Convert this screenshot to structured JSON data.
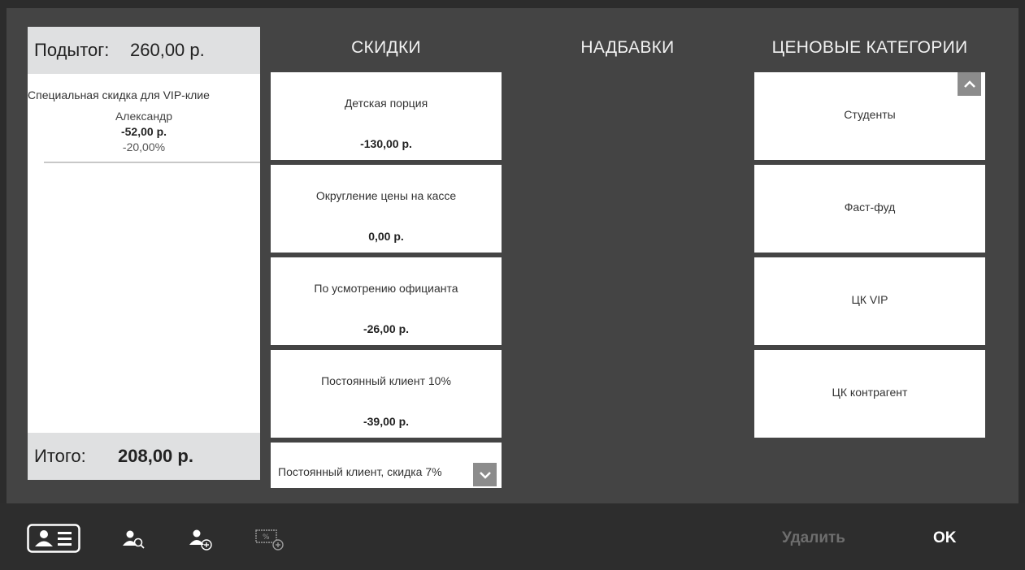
{
  "receipt": {
    "subtotal_label": "Подытог:",
    "subtotal_value": "260,00 р.",
    "discount_name": "Специальная скидка для VIP-клие",
    "discount_customer": "Александр",
    "discount_amount": "-52,00 р.",
    "discount_percent": "-20,00%",
    "total_label": "Итого:",
    "total_value": "208,00 р."
  },
  "columns": {
    "discounts": "СКИДКИ",
    "surcharges": "НАДБАВКИ",
    "price_categories": "ЦЕНОВЫЕ КАТЕГОРИИ"
  },
  "discounts": [
    {
      "name": "Детская порция",
      "amount": "-130,00 р."
    },
    {
      "name": "Округление цены на кассе",
      "amount": "0,00 р."
    },
    {
      "name": "По усмотрению официанта",
      "amount": "-26,00 р."
    },
    {
      "name": "Постоянный клиент 10%",
      "amount": "-39,00 р."
    },
    {
      "name": "Постоянный клиент, скидка 7%",
      "amount": ""
    }
  ],
  "price_categories": [
    {
      "name": "Студенты"
    },
    {
      "name": "Фаст-фуд"
    },
    {
      "name": "ЦК VIP"
    },
    {
      "name": "ЦК контрагент"
    }
  ],
  "icons": {
    "scroll_up": "chevron-up-icon",
    "scroll_down": "chevron-down-icon",
    "toolbar": [
      "customer-card-icon",
      "customer-search-icon",
      "customer-add-icon",
      "add-discount-card-icon"
    ]
  },
  "actions": {
    "delete_label": "Удалить",
    "ok_label": "OK"
  },
  "colors": {
    "background": "#444444",
    "toolbar": "#2d2d2d",
    "card": "#ffffff",
    "header_bar": "#dfe0e1",
    "disabled_text": "#6e6e6e"
  }
}
